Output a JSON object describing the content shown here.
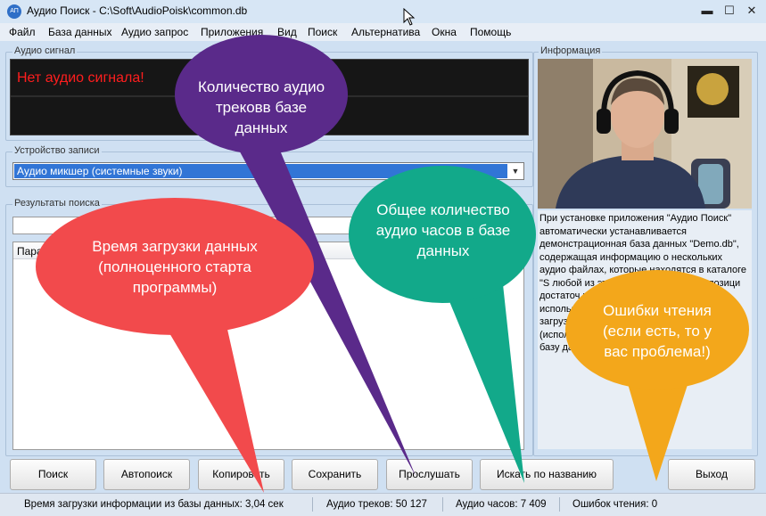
{
  "window": {
    "icon_text": "АП",
    "title": "Аудио Поиск - C:\\Soft\\AudioPoisk\\common.db",
    "minimize_glyph": "▬",
    "maximize_glyph": "☐",
    "close_glyph": "✕"
  },
  "menu": [
    "Файл",
    "База данных",
    "Аудио запрос",
    "Приложения",
    "Вид",
    "Поиск",
    "Альтернатива",
    "Окна",
    "Помощь"
  ],
  "audio_signal": {
    "title": "Аудио сигнал",
    "message": "Нет аудио сигнала!"
  },
  "recording_device": {
    "title": "Устройство записи",
    "selected": "Аудио микшер (системные звуки)"
  },
  "search_results": {
    "title": "Результаты поиска",
    "column_header": "Пара"
  },
  "info_panel": {
    "title": "Информация",
    "text": "При установке приложения \"Аудио Поиск\" автоматически устанавливается демонстрационная база данных \"Demo.db\", содержащая информацию о нескольких аудио файлах, которые находятся в каталоге \"S                         любой из этих                          подож                          кнопк                          вывес                          позици                          достаточ                          работоспособ                           для серьёзного использования программы \"Аудио Поиск\" загрузите полную базу данных с сайта (используйте меню \"База данных -> Скачать базу данных\") и выберите её."
  },
  "buttons": {
    "search": "Поиск",
    "autosearch": "Автопоиск",
    "copy": "Копировать",
    "save": "Сохранить",
    "listen": "Прослушать",
    "search_by_name": "Искать по названию",
    "exit": "Выход"
  },
  "status": {
    "load_time": "Время загрузки информации из базы данных: 3,04 сек",
    "tracks": "Аудио треков: 50 127",
    "hours": "Аудио часов: 7 409",
    "errors": "Ошибок чтения: 0"
  },
  "callouts": {
    "tracks": "Количество аудио трековв базе данных",
    "load_time": "Время загрузки данных (полноценного старта программы)",
    "hours": "Общее количество аудио часов в базе данных",
    "errors": "Ошибки чтения (если есть, то у вас проблема!)"
  },
  "colors": {
    "signal_text": "#ff1e1e",
    "selection": "#3175d6",
    "callout_purple": "#5a2a8a",
    "callout_red": "#f24a4c",
    "callout_green": "#12a98a",
    "callout_orange": "#f3a71b"
  }
}
